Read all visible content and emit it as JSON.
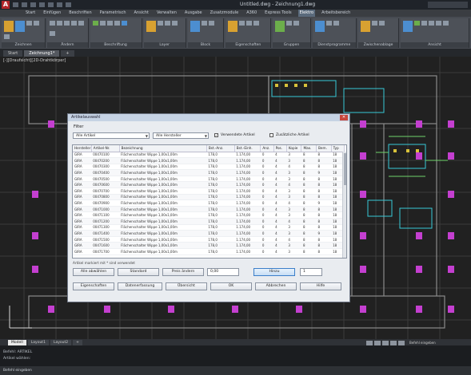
{
  "titlebar": {
    "title": "Untitled.dwg - Zeichnung1.dwg"
  },
  "ribbon": {
    "tabs": [
      "Start",
      "Einfügen",
      "Beschriften",
      "Parametrisch",
      "Ansicht",
      "Verwalten",
      "Ausgabe",
      "Zusatzmodule",
      "A360",
      "Express Tools",
      "Elektro",
      "Arbeitsbereich"
    ],
    "active_tab": "Elektro",
    "panels": [
      "Zeichnen",
      "Ändern",
      "Beschriftung",
      "Layer",
      "Block",
      "Eigenschaften",
      "Gruppen",
      "Dienstprogramme",
      "Zwischenablage",
      "Ansicht"
    ]
  },
  "doctabs": {
    "home": "Start",
    "drawing": "Zeichnung1*",
    "plus": "+"
  },
  "canvas": {
    "view_label": "[-][Draufsicht][2D-Drahtkörper]"
  },
  "dialog": {
    "title": "Artikelauswahl",
    "close": "✕",
    "filter_label": "Filter",
    "filter1": "Alle Artikel",
    "filter2": "Alle Hersteller",
    "check_used": "Verwendete Artikel",
    "check_additional": "Zusätzliche Artikel",
    "columns": [
      "Hersteller",
      "Artikel-Nr.",
      "Bezeichnung",
      "Bst.-Anz.",
      "Bst.-Einh.",
      "Anz.",
      "Pos.",
      "Kopie",
      "Max.",
      "Bem.",
      "Typ"
    ],
    "rows": [
      [
        "GIRA",
        "00470100",
        "Flächenschalter Wippe 1,00x1,00m",
        "178,0",
        "1.174,00",
        "0",
        "4",
        "3",
        "8",
        "8",
        "18"
      ],
      [
        "GIRA",
        "00470200",
        "Flächenschalter Wippe 1,00x1,00m",
        "178,0",
        "1.174,00",
        "0",
        "4",
        "3",
        "8",
        "8",
        "18"
      ],
      [
        "GIRA",
        "00470300",
        "Flächenschalter Wippe 1,00x1,00m",
        "178,0",
        "1.174,00",
        "0",
        "4",
        "4",
        "8",
        "8",
        "18"
      ],
      [
        "GIRA",
        "00470400",
        "Flächenschalter Wippe 1,00x1,00m",
        "178,0",
        "1.174,00",
        "0",
        "4",
        "3",
        "8",
        "9",
        "18"
      ],
      [
        "GIRA",
        "00470500",
        "Flächenschalter Wippe 1,00x1,00m",
        "178,0",
        "1.174,00",
        "0",
        "4",
        "3",
        "8",
        "8",
        "18"
      ],
      [
        "GIRA",
        "00470600",
        "Flächenschalter Wippe 1,00x1,00m",
        "178,0",
        "1.174,00",
        "0",
        "4",
        "4",
        "8",
        "8",
        "18"
      ],
      [
        "GIRA",
        "00470700",
        "Flächenschalter Wippe 1,00x1,00m",
        "178,0",
        "1.174,00",
        "0",
        "4",
        "3",
        "8",
        "8",
        "18"
      ],
      [
        "GIRA",
        "00470800",
        "Flächenschalter Wippe 1,00x1,00m",
        "178,0",
        "1.174,00",
        "0",
        "4",
        "3",
        "8",
        "8",
        "18"
      ],
      [
        "GIRA",
        "00470900",
        "Flächenschalter Wippe 1,00x1,00m",
        "178,0",
        "1.174,00",
        "0",
        "4",
        "4",
        "8",
        "9",
        "18"
      ],
      [
        "GIRA",
        "00471000",
        "Flächenschalter Wippe 1,00x1,00m",
        "178,0",
        "1.174,00",
        "0",
        "4",
        "3",
        "8",
        "8",
        "18"
      ],
      [
        "GIRA",
        "00471100",
        "Flächenschalter Wippe 1,00x1,00m",
        "178,0",
        "1.174,00",
        "0",
        "4",
        "3",
        "8",
        "8",
        "18"
      ],
      [
        "GIRA",
        "00471200",
        "Flächenschalter Wippe 1,00x1,00m",
        "178,0",
        "1.174,00",
        "0",
        "4",
        "4",
        "8",
        "8",
        "18"
      ],
      [
        "GIRA",
        "00471300",
        "Flächenschalter Wippe 1,00x1,00m",
        "178,0",
        "1.174,00",
        "0",
        "4",
        "3",
        "8",
        "8",
        "18"
      ],
      [
        "GIRA",
        "00471400",
        "Flächenschalter Wippe 1,00x1,00m",
        "178,0",
        "1.174,00",
        "0",
        "4",
        "3",
        "8",
        "9",
        "18"
      ],
      [
        "GIRA",
        "00471500",
        "Flächenschalter Wippe 1,00x1,00m",
        "178,0",
        "1.174,00",
        "0",
        "4",
        "4",
        "8",
        "8",
        "18"
      ],
      [
        "GIRA",
        "00471600",
        "Flächenschalter Wippe 1,00x1,00m",
        "178,0",
        "1.174,00",
        "0",
        "4",
        "3",
        "8",
        "8",
        "18"
      ],
      [
        "GIRA",
        "00471700",
        "Flächenschalter Wippe 1,00x1,00m",
        "178,0",
        "1.174,00",
        "0",
        "4",
        "3",
        "8",
        "8",
        "18"
      ]
    ],
    "note": "Artikel markiert mit * sind verwendet",
    "btn_unselect": "Alle abwählen",
    "btn_default": "Standard",
    "btn_change_price": "Preis ändern",
    "price_value": "0,00",
    "btn_add": "Hinzu",
    "qty_value": "1",
    "btn_properties": "Eigenschaften",
    "btn_data_entry": "Datenerfassung",
    "btn_overview": "Übersicht",
    "btn_ok": "OK",
    "btn_cancel": "Abbrechen",
    "btn_help": "Hilfe"
  },
  "layouttabs": [
    "Modell",
    "Layout1",
    "Layout2",
    "+"
  ],
  "statusbar": {
    "text": "Befehl eingeben"
  },
  "command": {
    "history1": "Befehl: ARTIKEL",
    "history2": "Artikel wählen:",
    "input": "Befehl eingeben"
  },
  "colors": {
    "accent": "#5a6a7c",
    "dialog_bg": "#e9ecf0",
    "drawing_bg": "#212121",
    "magenta": "#c43fd0",
    "cyan": "#38c9d6",
    "yellow": "#d8c23a"
  }
}
